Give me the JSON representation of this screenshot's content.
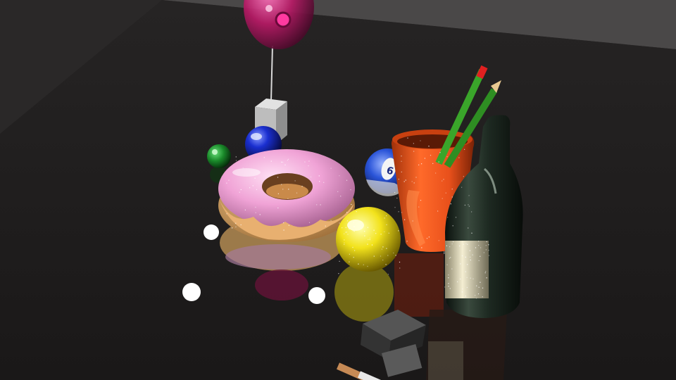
{
  "scene": {
    "kind": "3d-render",
    "background_color": "#2a2828",
    "floor_color": "#211f1f",
    "wall_color": "#4a4848",
    "objects": [
      {
        "name": "balloon",
        "color": "#c2186b"
      },
      {
        "name": "gift-box",
        "color": "#c8c8c8"
      },
      {
        "name": "blue-ball",
        "color": "#1a2fd0"
      },
      {
        "name": "green-ornament",
        "color": "#1a8a2a"
      },
      {
        "name": "donut",
        "icing_color": "#f0a3d6",
        "dough_color": "#d8a567"
      },
      {
        "name": "billiard-ball",
        "color": "#2a54d8"
      },
      {
        "name": "mug",
        "color": "#e8501b"
      },
      {
        "name": "pencil",
        "color": "#3aa52a"
      },
      {
        "name": "yellow-ball",
        "color": "#f2e21b"
      },
      {
        "name": "bottle",
        "color": "#1e2a22",
        "label_color": "#ece6c8"
      },
      {
        "name": "lighter",
        "color": "#444444"
      },
      {
        "name": "cigarette",
        "color": "#c68a55"
      },
      {
        "name": "light-orb",
        "color": "#ffffff"
      }
    ]
  }
}
